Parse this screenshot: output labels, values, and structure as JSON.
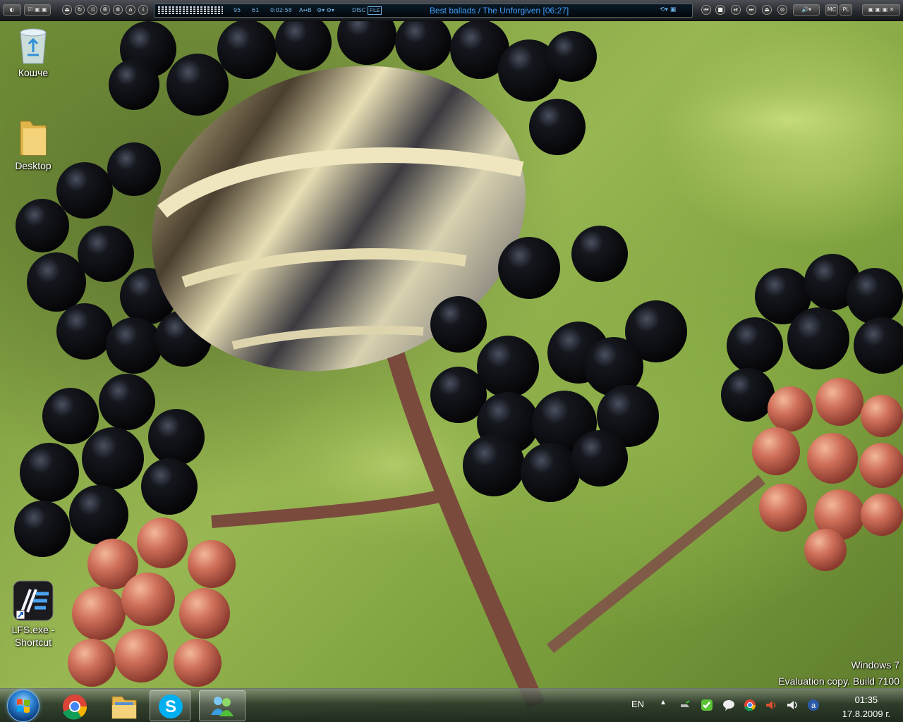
{
  "player": {
    "display": {
      "bitrate": "95",
      "khz": "61",
      "time": "0:02:58",
      "mode_label": "A↔B",
      "disc_label": "DISC",
      "file_label": "FILE",
      "song_title": "Best ballads / The Unforgiven",
      "song_length": "[06:27]"
    },
    "right_buttons": {
      "mc": "MC",
      "pl": "PL"
    }
  },
  "desktop": {
    "icons": [
      {
        "label": "Кошче",
        "icon": "recycle-bin-icon"
      },
      {
        "label": "Desktop",
        "icon": "folder-icon"
      },
      {
        "label": "LFS.exe -\nShortcut",
        "label_line1": "LFS.exe -",
        "label_line2": "Shortcut",
        "icon": "lfs-shortcut-icon"
      }
    ]
  },
  "watermark": {
    "line1": "Windows 7",
    "line2": "Evaluation copy. Build 7100"
  },
  "taskbar": {
    "pinned": [
      {
        "name": "chrome",
        "icon": "chrome-icon",
        "active": false
      },
      {
        "name": "explorer",
        "icon": "folder-library-icon",
        "active": false
      },
      {
        "name": "skype",
        "icon": "skype-icon",
        "active": true
      },
      {
        "name": "messenger",
        "icon": "messenger-icon",
        "active": true
      }
    ],
    "tray": {
      "language": "EN",
      "time": "01:35",
      "date": "17.8.2009 г."
    }
  },
  "colors": {
    "song_text": "#3fa0ff",
    "display_bg": "#03080c",
    "taskbar": "#26342c"
  }
}
